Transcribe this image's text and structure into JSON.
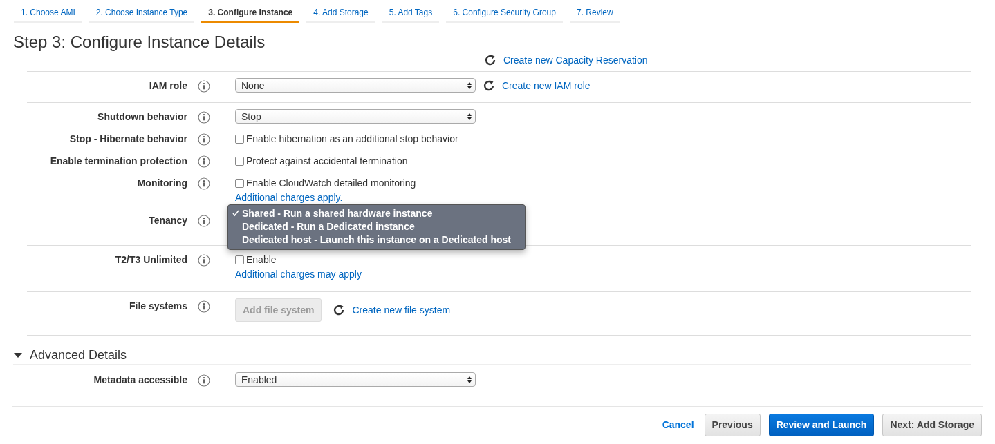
{
  "tabs": [
    {
      "label": "1. Choose AMI",
      "selected": false
    },
    {
      "label": "2. Choose Instance Type",
      "selected": false
    },
    {
      "label": "3. Configure Instance",
      "selected": true
    },
    {
      "label": "4. Add Storage",
      "selected": false
    },
    {
      "label": "5. Add Tags",
      "selected": false
    },
    {
      "label": "6. Configure Security Group",
      "selected": false
    },
    {
      "label": "7. Review",
      "selected": false
    }
  ],
  "title": "Step 3: Configure Instance Details",
  "sections": [
    [
      {
        "kind": "link",
        "link": "Create new Capacity Reservation"
      }
    ],
    [
      {
        "kind": "select",
        "label": "IAM role",
        "value": "None",
        "link": "Create new IAM role"
      }
    ],
    [
      {
        "kind": "select",
        "label": "Shutdown behavior",
        "value": "Stop"
      },
      {
        "kind": "checkbox",
        "label": "Stop - Hibernate behavior",
        "text": "Enable hibernation as an additional stop behavior",
        "checked": false
      },
      {
        "kind": "checkbox",
        "label": "Enable termination protection",
        "text": "Protect against accidental termination",
        "checked": false
      },
      {
        "kind": "checkbox",
        "label": "Monitoring",
        "text": "Enable CloudWatch detailed monitoring",
        "checked": false,
        "note": "Additional charges apply."
      },
      {
        "kind": "menu",
        "label": "Tenancy",
        "options": [
          {
            "label": "Shared - Run a shared hardware instance",
            "selected": true
          },
          {
            "label": "Dedicated - Run a Dedicated instance",
            "selected": false
          },
          {
            "label": "Dedicated host - Launch this instance on a Dedicated host",
            "selected": false
          }
        ]
      }
    ],
    [
      {
        "kind": "checkbox",
        "label": "T2/T3 Unlimited",
        "text": "Enable",
        "checked": false,
        "note": "Additional charges may apply"
      }
    ],
    [
      {
        "kind": "button",
        "label": "File systems",
        "button": "Add file system",
        "disabled": true,
        "link": "Create new file system"
      }
    ]
  ],
  "advanced": {
    "title": "Advanced Details",
    "expanded": true,
    "rows": [
      {
        "kind": "select",
        "label": "Metadata accessible",
        "value": "Enabled"
      }
    ]
  },
  "footer": {
    "cancel": "Cancel",
    "buttons": [
      {
        "label": "Previous",
        "primary": false
      },
      {
        "label": "Review and Launch",
        "primary": true
      },
      {
        "label": "Next: Add Storage",
        "primary": false
      }
    ]
  }
}
